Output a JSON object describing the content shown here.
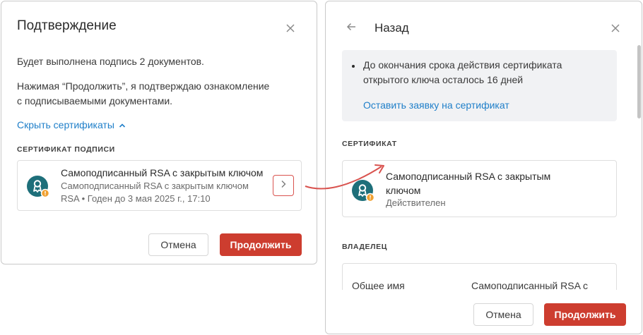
{
  "left_dialog": {
    "title": "Подтверждение",
    "intro": "Будет выполнена подпись 2 документов.",
    "consent_line1": "Нажимая “Продолжить”, я подтверждаю ознакомление",
    "consent_line2": "с подписываемыми документами.",
    "toggle_link": "Скрыть сертификаты",
    "section_label": "СЕРТИФИКАТ ПОДПИСИ",
    "certificate": {
      "title": "Самоподписанный RSA с закрытым ключом",
      "subtitle_line1": "Самоподписанный RSA с закрытым ключом",
      "subtitle_line2": "RSA • Годен до 3 мая 2025 г., 17:10"
    },
    "cancel_label": "Отмена",
    "continue_label": "Продолжить"
  },
  "right_dialog": {
    "back_label": "Назад",
    "notice_line1": "До окончания срока действия сертификата",
    "notice_line2": "открытого ключа осталось 16 дней",
    "request_link": "Оставить заявку на сертификат",
    "certificate_section_label": "СЕРТИФИКАТ",
    "certificate": {
      "title_line1": "Самоподписанный RSA с закрытым",
      "title_line2": "ключом",
      "status": "Действителен"
    },
    "owner_section_label": "ВЛАДЕЛЕЦ",
    "owner": {
      "field_label": "Общее имя",
      "field_value": "Самоподписанный RSA с"
    },
    "cancel_label": "Отмена",
    "continue_label": "Продолжить"
  },
  "icons": {
    "close": "close-icon",
    "back": "arrow-left-icon",
    "chevron_up": "chevron-up-icon",
    "chevron_right": "chevron-right-icon",
    "certificate": "certificate-icon",
    "warning_badge": "warning-badge-icon"
  },
  "colors": {
    "accent": "#cd3d2f",
    "link": "#1f7fc9",
    "cert_icon": "#1e6f7a",
    "badge": "#f0a030",
    "info_bg": "#f1f2f4"
  }
}
